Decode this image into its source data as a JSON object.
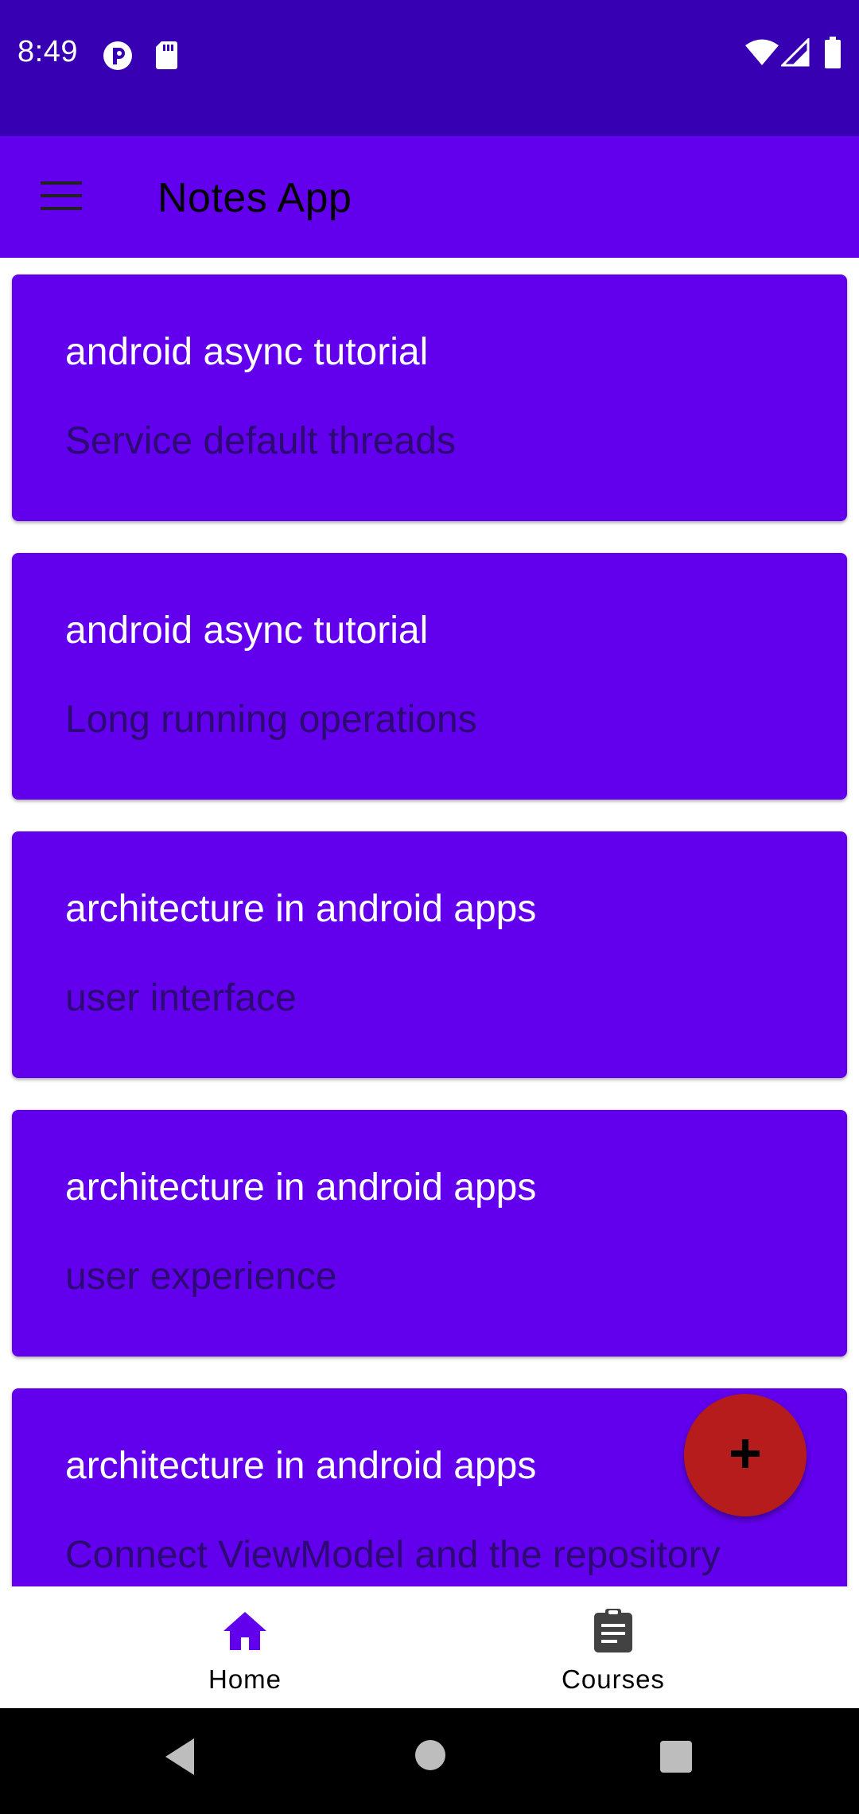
{
  "status_bar": {
    "time": "8:49",
    "left_icons": [
      "p-badge-icon",
      "sd-card-icon"
    ],
    "right_icons": [
      "wifi-icon",
      "cell-signal-icon",
      "battery-icon"
    ]
  },
  "app_bar": {
    "title": "Notes App",
    "menu_icon": "hamburger-menu-icon"
  },
  "notes": [
    {
      "title": "android async tutorial",
      "subtitle": "Service default threads"
    },
    {
      "title": "android async tutorial",
      "subtitle": "Long running operations"
    },
    {
      "title": "architecture in android apps",
      "subtitle": "user interface"
    },
    {
      "title": "architecture in android apps",
      "subtitle": "user experience"
    },
    {
      "title": "architecture in android apps",
      "subtitle": "Connect ViewModel and the repository"
    }
  ],
  "fab": {
    "icon": "plus-icon"
  },
  "bottom_nav": {
    "items": [
      {
        "label": "Home",
        "icon": "home-icon",
        "selected": true
      },
      {
        "label": "Courses",
        "icon": "clipboard-icon",
        "selected": false
      }
    ]
  },
  "system_nav": {
    "buttons": [
      "back-icon",
      "home-circle-icon",
      "recents-icon"
    ]
  },
  "colors": {
    "status_bar": "#3700b3",
    "primary": "#6200ee",
    "fab": "#b71c1c",
    "subtitle_text": "#2d0a73"
  }
}
